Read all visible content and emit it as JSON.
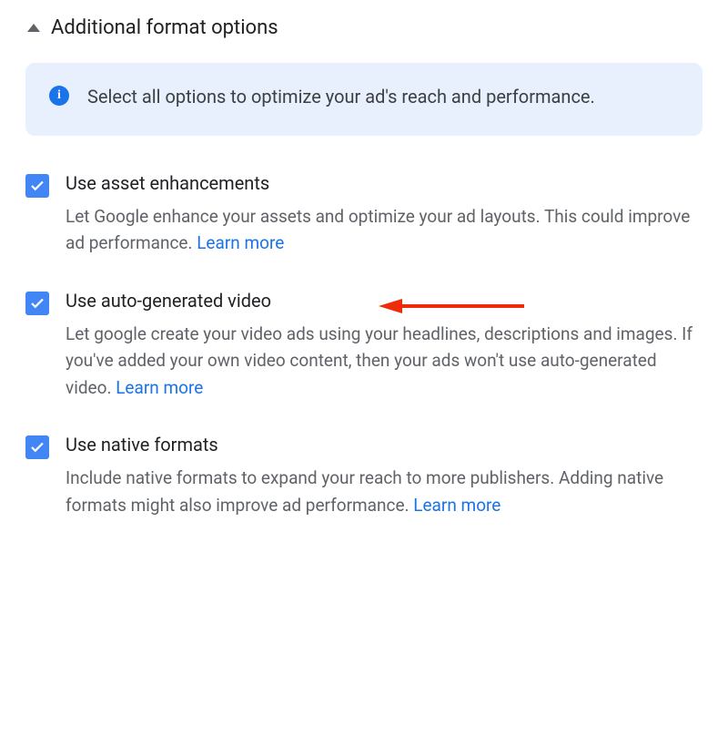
{
  "section": {
    "title": "Additional format options"
  },
  "banner": {
    "text": "Select all options to optimize your ad's reach and performance."
  },
  "options": [
    {
      "checked": true,
      "title": "Use asset enhancements",
      "desc": "Let Google enhance your assets and optimize your ad layouts. This could improve ad performance. ",
      "learn_more": "Learn more"
    },
    {
      "checked": true,
      "title": "Use auto-generated video",
      "desc": "Let google create your video ads using your headlines, descriptions and images. If you've added your own video content, then your ads won't use auto-generated video. ",
      "learn_more": "Learn more",
      "highlighted": true
    },
    {
      "checked": true,
      "title": "Use native formats",
      "desc": "Include native formats to expand your reach to more publishers. Adding native formats might also improve ad performance. ",
      "learn_more": "Learn more"
    }
  ]
}
